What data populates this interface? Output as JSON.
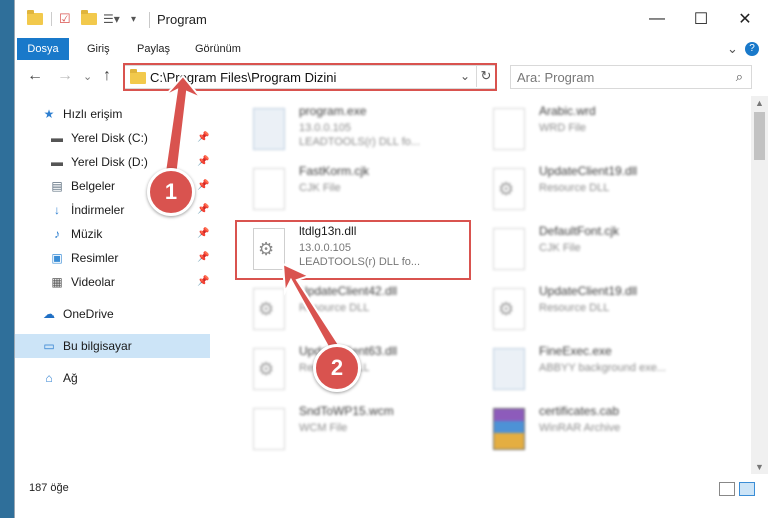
{
  "titlebar": {
    "title": "Program",
    "minimize": "—",
    "maximize": "☐",
    "close": "✕"
  },
  "ribbon": {
    "tabs": [
      "Dosya",
      "Giriş",
      "Paylaş",
      "Görünüm"
    ],
    "expand": "⌄",
    "help": "?"
  },
  "navbar": {
    "back": "←",
    "forward": "→",
    "recent": "⌄",
    "up": "↑",
    "address": "C:\\Program Files\\Program Dizini",
    "address_chevron": "⌄",
    "refresh": "↻",
    "search_placeholder": "Ara: Program",
    "search_icon": "⌕"
  },
  "sidebar": {
    "items": [
      {
        "label": "Hızlı erişim",
        "icon": "star-icon",
        "glyph": "★",
        "color": "#2e7fd0"
      },
      {
        "label": "Yerel Disk (C:)",
        "icon": "drive-icon",
        "glyph": "▬",
        "color": "#555555",
        "pinned": true
      },
      {
        "label": "Yerel Disk (D:)",
        "icon": "drive-icon",
        "glyph": "▬",
        "color": "#555555",
        "pinned": true
      },
      {
        "label": "Belgeler",
        "icon": "documents-icon",
        "glyph": "▤",
        "color": "#5a6c7d",
        "pinned": true
      },
      {
        "label": "İndirmeler",
        "icon": "download-icon",
        "glyph": "↓",
        "color": "#2e7fd0",
        "pinned": true
      },
      {
        "label": "Müzik",
        "icon": "music-icon",
        "glyph": "♪",
        "color": "#2e7fd0",
        "pinned": true
      },
      {
        "label": "Resimler",
        "icon": "pictures-icon",
        "glyph": "▣",
        "color": "#3a8dd6",
        "pinned": true
      },
      {
        "label": "Videolar",
        "icon": "videos-icon",
        "glyph": "▦",
        "color": "#555555",
        "pinned": true
      },
      {
        "label": "OneDrive",
        "icon": "cloud-icon",
        "glyph": "☁",
        "color": "#1f6fc4"
      },
      {
        "label": "Bu bilgisayar",
        "icon": "computer-icon",
        "glyph": "▭",
        "color": "#2e7fd0",
        "selected": true
      },
      {
        "label": "Ağ",
        "icon": "network-icon",
        "glyph": "⌂",
        "color": "#2e7fd0"
      }
    ],
    "pin_glyph": "📌"
  },
  "files": [
    {
      "name": "program.exe",
      "line2": "13.0.0.105",
      "line3": "LEADTOOLS(r) DLL fo...",
      "kind": "exe"
    },
    {
      "name": "Arabic.wrd",
      "line2": "WRD File",
      "line3": "",
      "kind": "doc"
    },
    {
      "name": "FastKorm.cjk",
      "line2": "CJK File",
      "line3": "",
      "kind": "doc"
    },
    {
      "name": "UpdateClient19.dll",
      "line2": "Resource DLL",
      "line3": "",
      "kind": "dll"
    },
    {
      "name": "ltdlg13n.dll",
      "line2": "13.0.0.105",
      "line3": "LEADTOOLS(r) DLL fo...",
      "kind": "dll"
    },
    {
      "name": "DefaultFont.cjk",
      "line2": "CJK File",
      "line3": "",
      "kind": "doc"
    },
    {
      "name": "UpdateClient42.dll",
      "line2": "Resource DLL",
      "line3": "",
      "kind": "dll"
    },
    {
      "name": "UpdateClient19.dll",
      "line2": "Resource DLL",
      "line3": "",
      "kind": "dll"
    },
    {
      "name": "UpdateClient63.dll",
      "line2": "Resource DLL",
      "line3": "",
      "kind": "dll"
    },
    {
      "name": "FineExec.exe",
      "line2": "ABBYY background exe...",
      "line3": "",
      "kind": "exe"
    },
    {
      "name": "SndToWP15.wcm",
      "line2": "WCM File",
      "line3": "",
      "kind": "doc"
    },
    {
      "name": "certificates.cab",
      "line2": "WinRAR Archive",
      "line3": "",
      "kind": "rar"
    }
  ],
  "status": {
    "count": "187 öğe"
  },
  "annotations": {
    "step1": "1",
    "step2": "2",
    "highlight_color": "#d9534f"
  }
}
